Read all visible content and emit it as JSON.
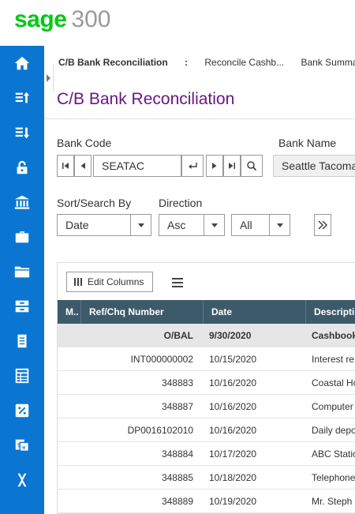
{
  "header": {
    "logo_brand": "sage",
    "logo_number": "300"
  },
  "sidebar": {
    "items": [
      {
        "icon": "home-icon"
      },
      {
        "icon": "upload-list-icon"
      },
      {
        "icon": "download-list-icon"
      },
      {
        "icon": "lock-icon"
      },
      {
        "icon": "bank-icon"
      },
      {
        "icon": "briefcase-icon"
      },
      {
        "icon": "folder-icon"
      },
      {
        "icon": "drawer-icon"
      },
      {
        "icon": "document-icon"
      },
      {
        "icon": "spreadsheet-icon"
      },
      {
        "icon": "percent-icon"
      },
      {
        "icon": "currency-icon"
      },
      {
        "icon": "tools-icon"
      }
    ],
    "accent": "#0a76d2"
  },
  "breadcrumb": {
    "item1": "C/B Bank Reconciliation",
    "sep": ":",
    "item2": "Reconcile Cashb...",
    "item3": "Bank Summa"
  },
  "page": {
    "title": "C/B Bank Reconciliation",
    "title_color": "#6b1682"
  },
  "form": {
    "bank_code_label": "Bank Code",
    "bank_code_value": "SEATAC",
    "bank_name_label": "Bank Name",
    "bank_name_value": "Seattle Tacoma",
    "sort_label": "Sort/Search By",
    "sort_value": "Date",
    "direction_label": "Direction",
    "direction_value": "Asc",
    "filter_value": "All"
  },
  "grid": {
    "edit_columns_label": "Edit Columns",
    "header_color": "#3c5a6a",
    "columns": [
      "M..",
      "Ref/Chq Number",
      "Date",
      "Descripti"
    ],
    "rows": [
      {
        "ref": "O/BAL",
        "date": "9/30/2020",
        "desc": "Cashbook"
      },
      {
        "ref": "INT000000002",
        "date": "10/15/2020",
        "desc": "Interest re"
      },
      {
        "ref": "348883",
        "date": "10/16/2020",
        "desc": "Coastal Ho"
      },
      {
        "ref": "348887",
        "date": "10/16/2020",
        "desc": "Computer"
      },
      {
        "ref": "DP0016102010",
        "date": "10/16/2020",
        "desc": "Daily depo"
      },
      {
        "ref": "348884",
        "date": "10/17/2020",
        "desc": "ABC Statio"
      },
      {
        "ref": "348885",
        "date": "10/18/2020",
        "desc": "Telephone"
      },
      {
        "ref": "348889",
        "date": "10/19/2020",
        "desc": "Mr. Steph"
      }
    ]
  }
}
